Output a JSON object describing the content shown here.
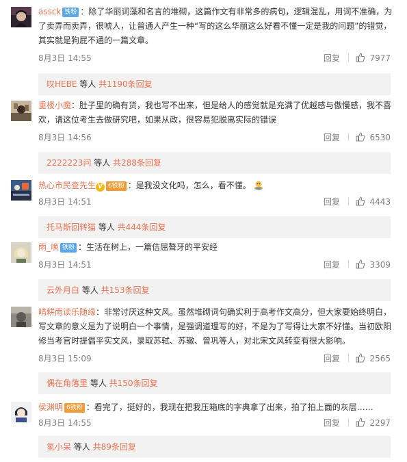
{
  "comments": [
    {
      "user": "assck",
      "badge": "铁粉",
      "text": "：除了华丽词藻和名言的堆砌，这篇作文有非常多的病句，逻辑混乱，用词不准确，为了卖弄而卖弄，很唬人，让普通人产生一种“写的这么华丽这么好看不懂一定是我的问题”的错觉，其实就是狗屁不通的一篇文章。",
      "date": "8月3日 14:55",
      "reply_label": "回复",
      "likes": "7977",
      "reply_user": "叹HEBE",
      "reply_mid": " 等人 ",
      "reply_count": "共1190条回复"
    },
    {
      "user": "重楼小魔",
      "text": "：肚子里的确有货，我也写不出来，但是给人的感觉就是充满了优越感与傲慢感，我不喜欢，请这位考生去做研究吧，如果从政，很容易犯脱离实际的错误",
      "date": "8月3日 14:56",
      "reply_label": "回复",
      "likes": "6530",
      "reply_user": "2222223问",
      "reply_mid": " 等人 ",
      "reply_count": "共288条回复"
    },
    {
      "user": "热心市民查先生",
      "vmark": "V",
      "badge": "铁粉",
      "badge_level": "6",
      "text": "：是我没文化吗，怎么，看不懂。",
      "date": "8月3日 14:51",
      "reply_label": "回复",
      "likes": "4443",
      "reply_user": "托马斯回转猫",
      "reply_mid": " 等人 ",
      "reply_count": "共444条回复"
    },
    {
      "user": "雨_唤",
      "badge": "铁粉",
      "text": "：生活在树上，一篇佶屈聱牙的平安经",
      "date": "8月3日 14:51",
      "reply_label": "回复",
      "likes": "3309",
      "reply_user": "云外月白",
      "reply_mid": " 等人 ",
      "reply_count": "共153条回复"
    },
    {
      "user": "晴耕雨读乐随缘",
      "text": "：非常讨厌这种文风。虽然堆砌词句确实利于高考作文高分，但大家要始终明白，写文章的意义是为了说明白一个事情，是强调道理写的好，不是为了写得让大家不好懂。当初欧阳修当考官时提倡平实文风，录取苏轼、苏辙、曾巩等人，对北宋文风转变有很大影响。",
      "date": "8月3日 15:09",
      "reply_label": "回复",
      "likes": "2565",
      "reply_user": "偶在角落里",
      "reply_mid": " 等人 ",
      "reply_count": "共150条回复"
    },
    {
      "user": "侯渊明",
      "badge": "铁粉",
      "badge_level": "6",
      "text": "：看完了，挺好的，我现在把我压箱底的字典拿了出来，拍了拍上面的灰层……",
      "date": "8月3日 14:55",
      "reply_label": "回复",
      "likes": "2297",
      "reply_user": "氢小呆",
      "reply_mid": " 等人 ",
      "reply_count": "共89条回复"
    }
  ]
}
